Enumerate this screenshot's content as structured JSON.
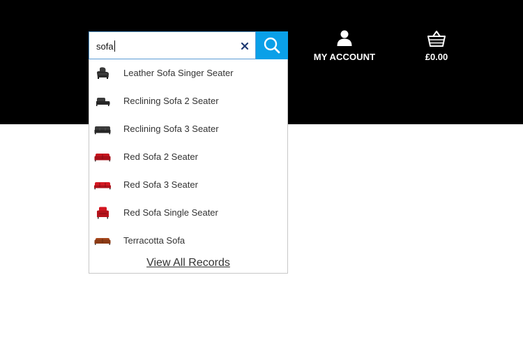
{
  "header": {
    "background": "#000000",
    "accent": "#0aa0e8"
  },
  "search": {
    "value": "sofa",
    "clear_icon": "close-icon",
    "submit_icon": "search-icon"
  },
  "account": {
    "label": "MY ACCOUNT",
    "icon": "user-icon"
  },
  "basket": {
    "label": "£0.00",
    "icon": "basket-icon"
  },
  "suggestions": [
    {
      "label": "Leather Sofa Singer Seater",
      "thumb": "dark-recliner-chair"
    },
    {
      "label": "Reclining Sofa 2 Seater",
      "thumb": "dark-sofa"
    },
    {
      "label": "Reclining Sofa 3 Seater",
      "thumb": "dark-sofa"
    },
    {
      "label": "Red Sofa 2 Seater",
      "thumb": "red-sofa"
    },
    {
      "label": "Red Sofa 3 Seater",
      "thumb": "red-sofa"
    },
    {
      "label": "Red Sofa Single Seater",
      "thumb": "red-armchair"
    },
    {
      "label": "Terracotta Sofa",
      "thumb": "terracotta-sofa"
    }
  ],
  "view_all": "View All Records"
}
